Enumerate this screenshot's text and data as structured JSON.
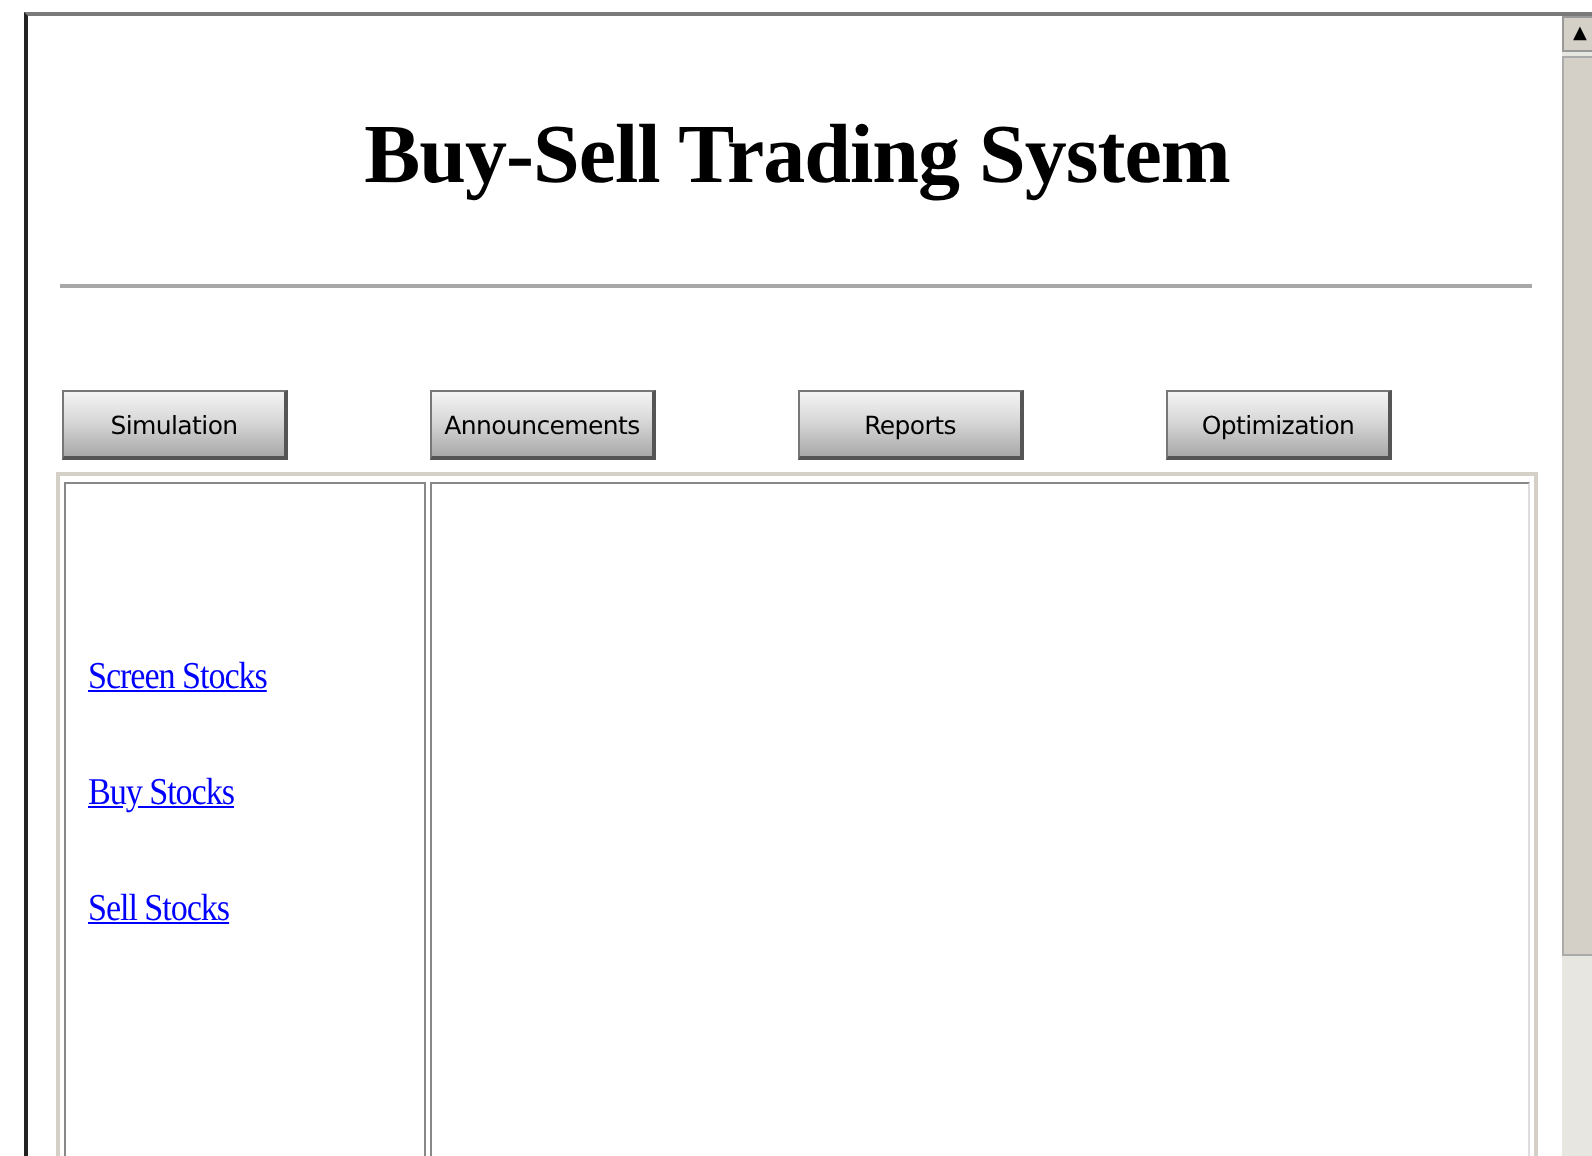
{
  "title": "Buy-Sell Trading System",
  "buttons": [
    {
      "label": "Simulation"
    },
    {
      "label": "Announcements"
    },
    {
      "label": "Reports"
    },
    {
      "label": "Optimization"
    }
  ],
  "sidebar": {
    "links": [
      {
        "label": "Screen Stocks"
      },
      {
        "label": "Buy Stocks"
      },
      {
        "label": "Sell Stocks"
      }
    ]
  },
  "scrollbar": {
    "up_arrow": "▲"
  }
}
